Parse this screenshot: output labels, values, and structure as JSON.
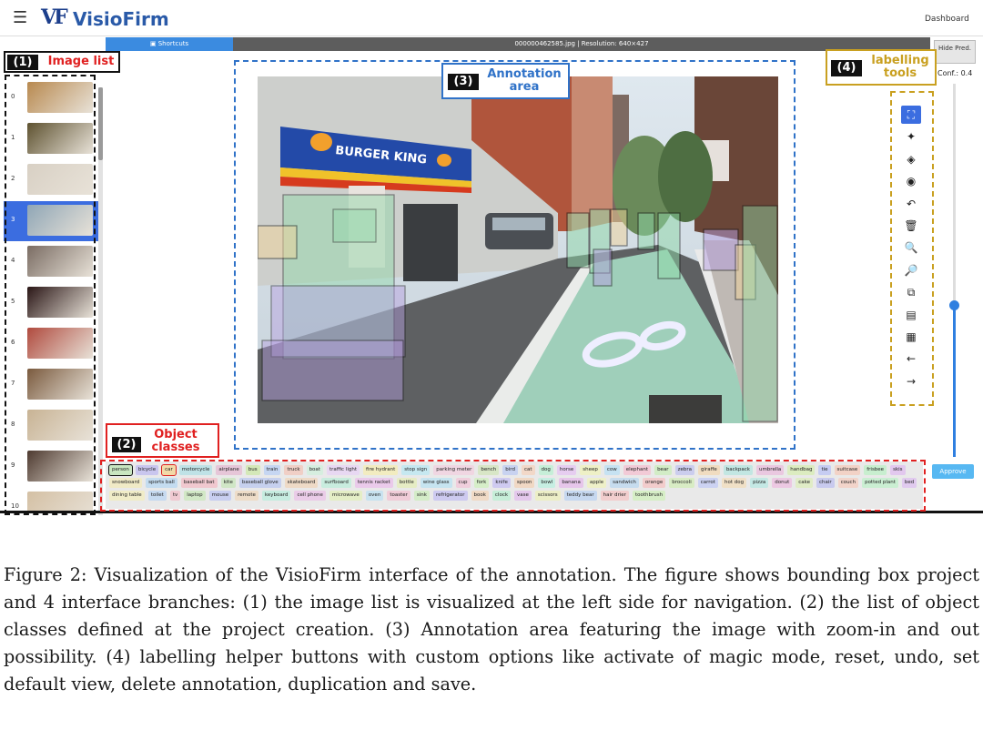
{
  "app": {
    "logo_mark": "VF",
    "name": "VisioFirm",
    "menu_icon": "hamburger-icon",
    "dashboard_label": "Dashboard"
  },
  "toolbar": {
    "shortcuts_label": "Shortcuts",
    "file_info": "000000462585.jpg | Resolution: 640×427",
    "hide_pred_label": "Hide Pred.",
    "conf_label": "Conf.: 0.4",
    "conf_value": 0.4,
    "approve_label": "Approve"
  },
  "image_list": {
    "selected_index": 3,
    "items": [
      {
        "index": "0",
        "color": "#b8894f"
      },
      {
        "index": "1",
        "color": "#5e5230"
      },
      {
        "index": "2",
        "color": "#d8d0c4"
      },
      {
        "index": "3",
        "color": "#8fa6b6"
      },
      {
        "index": "4",
        "color": "#7a6c63"
      },
      {
        "index": "5",
        "color": "#2a1616"
      },
      {
        "index": "6",
        "color": "#b04a3e"
      },
      {
        "index": "7",
        "color": "#7a5a3e"
      },
      {
        "index": "8",
        "color": "#c8b394"
      },
      {
        "index": "9",
        "color": "#4e3a30"
      },
      {
        "index": "10",
        "color": "#d4c0a4"
      }
    ]
  },
  "annotation": {
    "image_text": "BURGER KING"
  },
  "tools": [
    {
      "name": "bbox-tool-icon",
      "glyph": "⛶",
      "active": true
    },
    {
      "name": "magic-wand-icon",
      "glyph": "✦"
    },
    {
      "name": "fill-icon",
      "glyph": "◈"
    },
    {
      "name": "view-icon",
      "glyph": "◉"
    },
    {
      "name": "undo-icon",
      "glyph": "↶"
    },
    {
      "name": "delete-icon",
      "glyph": "🗑"
    },
    {
      "name": "zoom-in-icon",
      "glyph": "🔍"
    },
    {
      "name": "zoom-out-icon",
      "glyph": "🔎"
    },
    {
      "name": "duplicate-icon",
      "glyph": "⧉"
    },
    {
      "name": "save-icon",
      "glyph": "▤"
    },
    {
      "name": "grid-icon",
      "glyph": "▦"
    },
    {
      "name": "prev-arrow-icon",
      "glyph": "←"
    },
    {
      "name": "next-arrow-icon",
      "glyph": "→"
    }
  ],
  "classes": [
    {
      "label": "person",
      "color": "#c9e6c0",
      "sel": "black"
    },
    {
      "label": "bicycle",
      "color": "#c9c6ee"
    },
    {
      "label": "car",
      "color": "#f2d9a8",
      "sel": "red"
    },
    {
      "label": "motorcycle",
      "color": "#bfe2e6"
    },
    {
      "label": "airplane",
      "color": "#e6c6d8"
    },
    {
      "label": "bus",
      "color": "#d4e8b8"
    },
    {
      "label": "train",
      "color": "#c6d6f2"
    },
    {
      "label": "truck",
      "color": "#f0cfc6"
    },
    {
      "label": "boat",
      "color": "#d6eedf"
    },
    {
      "label": "traffic light",
      "color": "#e8d8f2"
    },
    {
      "label": "fire hydrant",
      "color": "#f2ecc0"
    },
    {
      "label": "stop sign",
      "color": "#c6e8f0"
    },
    {
      "label": "parking meter",
      "color": "#f0d6e2"
    },
    {
      "label": "bench",
      "color": "#d8e6c6"
    },
    {
      "label": "bird",
      "color": "#c8d2f0"
    },
    {
      "label": "cat",
      "color": "#f2d8c8"
    },
    {
      "label": "dog",
      "color": "#c6eed8"
    },
    {
      "label": "horse",
      "color": "#e6cdf0"
    },
    {
      "label": "sheep",
      "color": "#eef0c6"
    },
    {
      "label": "cow",
      "color": "#c6e2f2"
    },
    {
      "label": "elephant",
      "color": "#f2cad6"
    },
    {
      "label": "bear",
      "color": "#d2ecc6"
    },
    {
      "label": "zebra",
      "color": "#cbcdee"
    },
    {
      "label": "giraffe",
      "color": "#f0dcc0"
    },
    {
      "label": "backpack",
      "color": "#c2e6e2"
    },
    {
      "label": "umbrella",
      "color": "#eac8e0"
    },
    {
      "label": "handbag",
      "color": "#dcecc0"
    },
    {
      "label": "tie",
      "color": "#c6ccf2"
    },
    {
      "label": "suitcase",
      "color": "#f2d2c6"
    },
    {
      "label": "frisbee",
      "color": "#c8eecf"
    },
    {
      "label": "skis",
      "color": "#e2c8ee"
    },
    {
      "label": "snowboard",
      "color": "#f0eac6"
    },
    {
      "label": "sports ball",
      "color": "#c4dcf0"
    },
    {
      "label": "baseball bat",
      "color": "#f0c8cf"
    },
    {
      "label": "kite",
      "color": "#d0e6c6"
    },
    {
      "label": "baseball glove",
      "color": "#c6d0ee"
    },
    {
      "label": "skateboard",
      "color": "#eedac6"
    },
    {
      "label": "surfboard",
      "color": "#c8ecde"
    },
    {
      "label": "tennis racket",
      "color": "#eacaea"
    },
    {
      "label": "bottle",
      "color": "#e6ecc4"
    },
    {
      "label": "wine glass",
      "color": "#c6e4f0"
    },
    {
      "label": "cup",
      "color": "#f0cedc"
    },
    {
      "label": "fork",
      "color": "#d6eec8"
    },
    {
      "label": "knife",
      "color": "#cfcaf0"
    },
    {
      "label": "spoon",
      "color": "#f0d8c4"
    },
    {
      "label": "bowl",
      "color": "#c6eee2"
    },
    {
      "label": "banana",
      "color": "#e6c6ea"
    },
    {
      "label": "apple",
      "color": "#eef0c8"
    },
    {
      "label": "sandwich",
      "color": "#c6dcee"
    },
    {
      "label": "orange",
      "color": "#f2cccc"
    },
    {
      "label": "broccoli",
      "color": "#d8ecc4"
    },
    {
      "label": "carrot",
      "color": "#ccd2f2"
    },
    {
      "label": "hot dog",
      "color": "#f0e0c6"
    },
    {
      "label": "pizza",
      "color": "#c4e8e4"
    },
    {
      "label": "donut",
      "color": "#ecc8e2"
    },
    {
      "label": "cake",
      "color": "#e0ecc6"
    },
    {
      "label": "chair",
      "color": "#c8caee"
    },
    {
      "label": "couch",
      "color": "#f2d4ca"
    },
    {
      "label": "potted plant",
      "color": "#caeed2"
    },
    {
      "label": "bed",
      "color": "#e0caee"
    },
    {
      "label": "dining table",
      "color": "#f0ecc8"
    },
    {
      "label": "toilet",
      "color": "#c6daf0"
    },
    {
      "label": "tv",
      "color": "#f0cad2"
    },
    {
      "label": "laptop",
      "color": "#d2e8c6"
    },
    {
      "label": "mouse",
      "color": "#c8cef0"
    },
    {
      "label": "remote",
      "color": "#eedcc8"
    },
    {
      "label": "keyboard",
      "color": "#c6ece0"
    },
    {
      "label": "cell phone",
      "color": "#eacce8"
    },
    {
      "label": "microwave",
      "color": "#e4eec6"
    },
    {
      "label": "oven",
      "color": "#c8e2f0"
    },
    {
      "label": "toaster",
      "color": "#f0ccd8"
    },
    {
      "label": "sink",
      "color": "#d4ecc8"
    },
    {
      "label": "refrigerator",
      "color": "#cdcaf0"
    },
    {
      "label": "book",
      "color": "#f0dac6"
    },
    {
      "label": "clock",
      "color": "#c6eed8"
    },
    {
      "label": "vase",
      "color": "#e4c8ec"
    },
    {
      "label": "scissors",
      "color": "#eceec6"
    },
    {
      "label": "teddy bear",
      "color": "#c6d8f0"
    },
    {
      "label": "hair drier",
      "color": "#f2cece"
    },
    {
      "label": "toothbrush",
      "color": "#d6eec6"
    }
  ],
  "callouts": {
    "c1": {
      "num": "(1)",
      "text": "Image list"
    },
    "c2": {
      "num": "(2)",
      "text": "Object classes"
    },
    "c3": {
      "num": "(3)",
      "text": "Annotation area"
    },
    "c4": {
      "num": "(4)",
      "text": "labelling tools"
    }
  },
  "colors": {
    "c1": "#111111",
    "c2": "#e02020",
    "c3": "#2f72c8",
    "c4": "#c9a020"
  },
  "caption": "Figure 2: Visualization of the VisioFirm interface of the annotation. The figure shows bounding box project and 4 interface branches: (1) the image list is visualized at the left side for navigation. (2) the list of object classes defined at the project creation. (3) Annotation area featuring the image with zoom-in and out possibility. (4) labelling helper buttons with custom options like activate of magic mode, reset, undo, set default view, delete annotation, duplication and save."
}
